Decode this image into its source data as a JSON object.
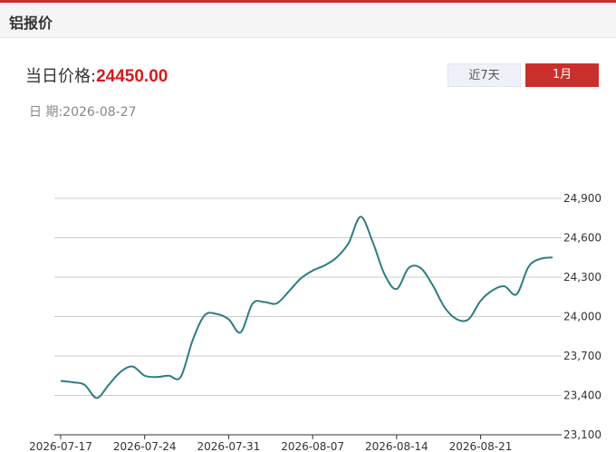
{
  "header": {
    "title": "铝报价"
  },
  "price": {
    "label": "当日价格:",
    "value": "24450.00"
  },
  "date": {
    "label": "日  期:",
    "value": "2026-08-27"
  },
  "tabs": [
    {
      "label": "近7天",
      "active": false
    },
    {
      "label": "1月",
      "active": true
    }
  ],
  "colors": {
    "accent": "#c9302c",
    "price": "#d7191f",
    "line": "#2e7d80",
    "grid": "#cccccc"
  },
  "chart_data": {
    "type": "line",
    "x_ticks": [
      "2026-07-17",
      "2026-07-24",
      "2026-07-31",
      "2026-08-07",
      "2026-08-14",
      "2026-08-21"
    ],
    "y_ticks": [
      "23,100",
      "23,400",
      "23,700",
      "24,000",
      "24,300",
      "24,600",
      "24,900"
    ],
    "ylim": [
      23100,
      24900
    ],
    "xlim": [
      "2026-07-17",
      "2026-08-27"
    ],
    "grid": true,
    "series": [
      {
        "x": [
          "2026-07-17",
          "2026-07-18",
          "2026-07-19",
          "2026-07-20",
          "2026-07-21",
          "2026-07-22",
          "2026-07-23",
          "2026-07-24",
          "2026-07-25",
          "2026-07-26",
          "2026-07-27",
          "2026-07-28",
          "2026-07-29",
          "2026-07-30",
          "2026-07-31",
          "2026-08-01",
          "2026-08-02",
          "2026-08-03",
          "2026-08-04",
          "2026-08-05",
          "2026-08-06",
          "2026-08-07",
          "2026-08-08",
          "2026-08-09",
          "2026-08-10",
          "2026-08-11",
          "2026-08-12",
          "2026-08-13",
          "2026-08-14",
          "2026-08-15",
          "2026-08-16",
          "2026-08-17",
          "2026-08-18",
          "2026-08-19",
          "2026-08-20",
          "2026-08-21",
          "2026-08-22",
          "2026-08-23",
          "2026-08-24",
          "2026-08-25",
          "2026-08-26",
          "2026-08-27"
        ],
        "values": [
          23510,
          23500,
          23480,
          23380,
          23480,
          23580,
          23620,
          23550,
          23540,
          23550,
          23540,
          23820,
          24010,
          24020,
          23980,
          23880,
          24100,
          24110,
          24100,
          24190,
          24290,
          24350,
          24390,
          24450,
          24560,
          24760,
          24570,
          24320,
          24210,
          24370,
          24370,
          24240,
          24070,
          23980,
          23980,
          24120,
          24200,
          24230,
          24170,
          24380,
          24440,
          24450
        ]
      }
    ]
  }
}
